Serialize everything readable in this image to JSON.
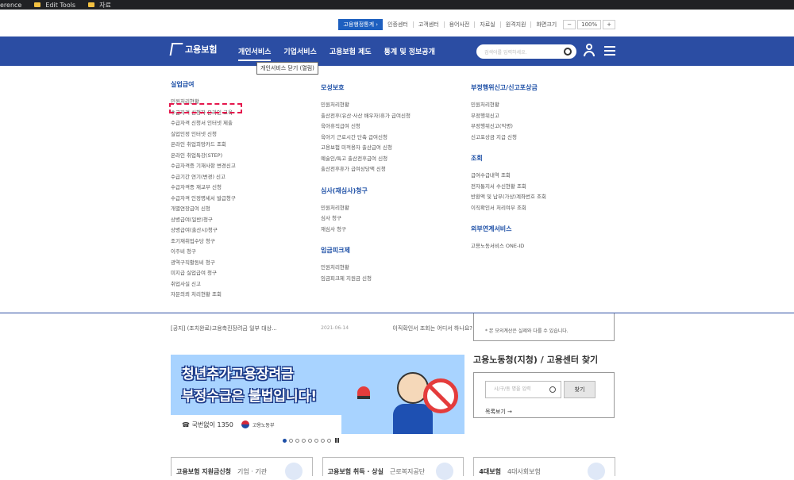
{
  "bookmarks": {
    "items": [
      {
        "label": "erence",
        "icon": "none"
      },
      {
        "label": "Edit Tools",
        "icon": "folder-icon"
      },
      {
        "label": "자료",
        "icon": "folder-icon"
      }
    ]
  },
  "utility": {
    "stats_button": "고용행정통계 ›",
    "links": [
      "인증센터",
      "고객센터",
      "용어사전",
      "자료실",
      "원격지원"
    ],
    "zoom_label": "화면크기",
    "zoom_minus": "−",
    "zoom_value": "100%",
    "zoom_plus": "+"
  },
  "header": {
    "logo": "고용보험",
    "nav": [
      "개인서비스",
      "기업서비스",
      "고용보험 제도",
      "통계 및 정보공개"
    ],
    "search_placeholder": "검색어를 입력하세요.",
    "tooltip": "개인서비스 닫기 (열림)"
  },
  "dropdown": {
    "col1": {
      "title": "실업급여",
      "items": [
        "민원처리현황",
        "수급자격 신청자 온라인 교육",
        "수급자격 신청서 인터넷 제출",
        "실업인정 인터넷 신청",
        "온라인 취업희망카드 조회",
        "온라인 취업특강(STEP)",
        "수급자격증 기재사항 변경신고",
        "수급기간 연기(변경) 신고",
        "수급자격증 재교부 신청",
        "수급자격 인정명세서 발급청구",
        "개별연장급여 신청",
        "상병급여(일반)청구",
        "상병급여(출산시)청구",
        "조기재취업수당 청구",
        "이주비 청구",
        "광역구직활동비 청구",
        "미지급 실업급여 청구",
        "취업사실 신고",
        "자문의뢰 처리현황 조회"
      ]
    },
    "col2": [
      {
        "title": "모성보호",
        "items": [
          "민원처리현황",
          "출산전후(유산·사산 배우자)휴가 급여신청",
          "육아휴직급여 신청",
          "육아기 근로시간 단축 급여신청",
          "고용보험 미적용자 출산급여 신청",
          "예술인/특고 출산전후급여 신청",
          "출산전후휴가 급여상당액 신청"
        ]
      },
      {
        "title": "심사(재심사)청구",
        "items": [
          "민원처리현황",
          "심사 청구",
          "재심사 청구"
        ]
      },
      {
        "title": "임금피크제",
        "items": [
          "민원처리현황",
          "임금피크제 지원금 신청"
        ]
      }
    ],
    "col3": [
      {
        "title": "부정행위신고/신고포상금",
        "items": [
          "민원처리현황",
          "부정행위신고",
          "부정행위신고(익명)",
          "신고포상금 지급 신청"
        ]
      },
      {
        "title": "조회",
        "items": [
          "급여수급내역 조회",
          "전자통지서 수신현황 조회",
          "반환액 및 납부(가상)계좌번호 조회",
          "이직확인서 처리여부 조회"
        ]
      },
      {
        "title": "외부연계서비스",
        "items": [
          "고용노동서비스 ONE-ID"
        ]
      }
    ]
  },
  "notices": [
    {
      "title": "[공지] (조치완료)고용촉진장려금 일부 대상...",
      "date": "2021-06-14"
    }
  ],
  "notice_side": {
    "title": "이직확인서 조회는 어디서 하나요?"
  },
  "side_box": {
    "note": "* 본 모의계산은 실제와 다를 수 있습니다."
  },
  "banner": {
    "line1": "청년추가고용장려금",
    "line2": "부정수급은 불법입니다!",
    "hotline": "국번없이 1350",
    "ministry": "고용노동부"
  },
  "slider": {
    "count": 8,
    "active": 0
  },
  "office": {
    "title": "고용노동청(지청) / 고용센터 찾기",
    "input_placeholder": "시/구/동 명을 입력",
    "find_button": "찾기",
    "more_link": "목록보기 →"
  },
  "cards": [
    {
      "title": "고용보험 지원금신청",
      "sub": "기업 · 기관"
    },
    {
      "title": "고용보험 취득 · 상실",
      "sub": "근로복지공단"
    },
    {
      "title": "4대보험",
      "sub": "4대사회보험"
    }
  ]
}
